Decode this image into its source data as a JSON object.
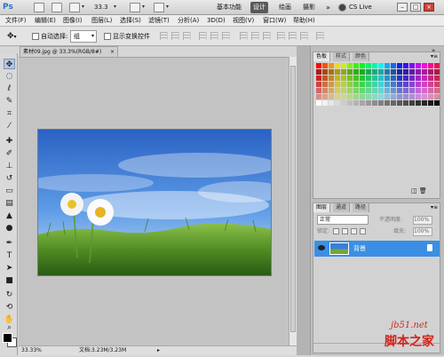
{
  "app": {
    "logo": "Ps"
  },
  "appbar": {
    "zoom": "33.3",
    "workspaces": [
      "基本功能",
      "设计",
      "绘画",
      "摄影"
    ],
    "active_workspace": "设计",
    "more": "»",
    "cs_live": "CS Live",
    "win_buttons": [
      "–",
      "□",
      "×"
    ]
  },
  "menubar": {
    "items": [
      "文件(F)",
      "编辑(E)",
      "图像(I)",
      "图层(L)",
      "选择(S)",
      "滤镜(T)",
      "分析(A)",
      "3D(D)",
      "视图(V)",
      "窗口(W)",
      "帮助(H)"
    ]
  },
  "options": {
    "auto_select_label": "自动选择:",
    "auto_select_value": "组",
    "show_transform_label": "显示变换控件"
  },
  "document": {
    "tab_title": "素材09.jpg @ 33.3%(RGB/8#)",
    "tab_close": "×",
    "status_zoom": "33.33%",
    "status_doc": "文档:3.23M/3.23M",
    "status_arrow": "▸"
  },
  "panels": {
    "swatch_tabs": [
      "色板",
      "样式",
      "颜色"
    ],
    "layer_tabs": [
      "图层",
      "通道",
      "路径"
    ],
    "blend_mode": "正常",
    "opacity_label": "不透明度:",
    "opacity_value": "100%",
    "lock_label": "锁定:",
    "fill_label": "填充:",
    "fill_value": "100%",
    "layer_name": "背景",
    "panel_menu": "▾≡"
  },
  "watermark": {
    "url": "jb51.net",
    "site": "脚本之家"
  },
  "colors": {
    "selected_layer": "#3a8fe4",
    "active_workspace_bg": "#5a5a5a"
  },
  "icons": [
    "ps-logo",
    "bridge-icon",
    "minibridge-icon",
    "view-extras-icon",
    "hand-icon",
    "zoom-icon",
    "arrange-icon",
    "screen-mode-icon",
    "move-icon",
    "marquee-icon",
    "lasso-icon",
    "quick-select-icon",
    "crop-icon",
    "eyedropper-icon",
    "heal-icon",
    "brush-icon",
    "stamp-icon",
    "history-brush-icon",
    "eraser-icon",
    "gradient-icon",
    "blur-icon",
    "dodge-icon",
    "pen-icon",
    "type-icon",
    "path-select-icon",
    "shape-icon",
    "3d-rotate-icon",
    "3d-orbit-icon",
    "hand-tool-icon",
    "zoom-tool-icon",
    "eye-icon",
    "lock-icon"
  ]
}
